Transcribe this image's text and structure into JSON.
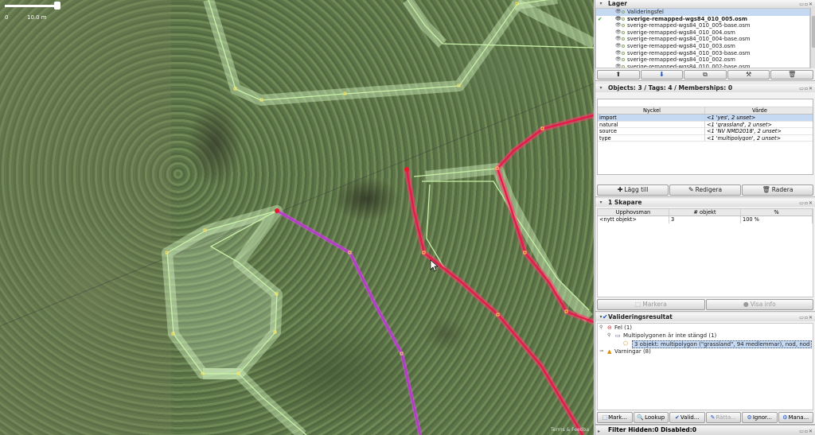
{
  "map": {
    "scale_zero": "0",
    "scale_label": "10.0 m",
    "attribution": "Terms & Feedba"
  },
  "layers_panel": {
    "title": "Lager",
    "items": [
      {
        "name": "Valideringsfel",
        "selected": true,
        "bold": false,
        "active_check": false
      },
      {
        "name": "sverige-remapped-wgs84_010_005.osm",
        "selected": false,
        "bold": true,
        "active_check": true
      },
      {
        "name": "sverige-remapped-wgs84_010_005-base.osm",
        "selected": false,
        "bold": false,
        "active_check": false
      },
      {
        "name": "sverige-remapped-wgs84_010_004.osm",
        "selected": false,
        "bold": false,
        "active_check": false
      },
      {
        "name": "sverige-remapped-wgs84_010_004-base.osm",
        "selected": false,
        "bold": false,
        "active_check": false
      },
      {
        "name": "sverige-remapped-wgs84_010_003.osm",
        "selected": false,
        "bold": false,
        "active_check": false
      },
      {
        "name": "sverige-remapped-wgs84_010_003-base.osm",
        "selected": false,
        "bold": false,
        "active_check": false
      },
      {
        "name": "sverige-remapped-wgs84_010_002.osm",
        "selected": false,
        "bold": false,
        "active_check": false
      },
      {
        "name": "sverige-remapped-wgs84_010_002-base.osm",
        "selected": false,
        "bold": false,
        "active_check": false
      }
    ]
  },
  "tags_panel": {
    "title": "Objects: 3 / Tags: 4 / Memberships: 0",
    "col_key": "Nyckel",
    "col_value": "Värde",
    "rows": [
      {
        "key": "import",
        "value": "<1 'yes', 2 unset>",
        "selected": true
      },
      {
        "key": "natural",
        "value": "<1 'grassland', 2 unset>",
        "selected": false
      },
      {
        "key": "source",
        "value": "<1 'NV NMD2018', 2 unset>",
        "selected": false
      },
      {
        "key": "type",
        "value": "<1 'multipolygon', 2 unset>",
        "selected": false
      }
    ],
    "btn_add": "Lägg till",
    "btn_edit": "Redigera",
    "btn_delete": "Radera"
  },
  "authors_panel": {
    "title": "1 Skapare",
    "col_author": "Upphovsman",
    "col_count": "# objekt",
    "col_pct": "%",
    "row_author": "<nytt objekt>",
    "row_count": "3",
    "row_pct": "100 %",
    "btn_select": "Markera",
    "btn_info": "Visa info"
  },
  "validation_panel": {
    "title": "Valideringsresultat",
    "errors": "Fel (1)",
    "group": "Multipolygonen är inte stängd (1)",
    "item": "3 objekt: multipolygon (\"grassland\", 94 medlemmar), nod, nod",
    "warnings": "Varningar (8)",
    "tabs": [
      "Mark...",
      "Lookup",
      "Valid...",
      "Rätta...",
      "Ignor...",
      "Mana..."
    ]
  },
  "filter_panel": {
    "title": "Filter Hidden:0 Disabled:0"
  },
  "colors": {
    "selection": "#c6d9f2",
    "error_way": "#e8184a",
    "member_way": "#d040e0",
    "area_outline": "#c8f0a8"
  }
}
